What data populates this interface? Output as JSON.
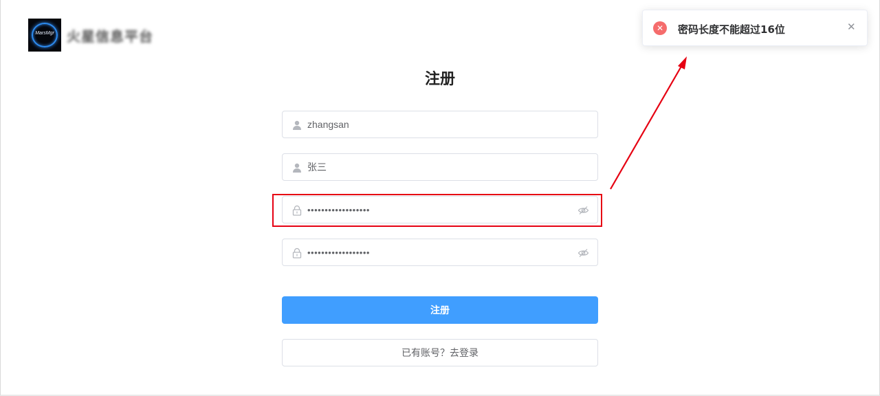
{
  "brand": {
    "logo_text": "MarsMgr",
    "name": "火星信息平台"
  },
  "toast": {
    "type": "error",
    "icon": "error-circle-icon",
    "message": "密码长度不能超过16位",
    "close_icon": "close-icon",
    "color": "#f56c6c"
  },
  "form": {
    "title": "注册",
    "username": {
      "value": "zhangsan",
      "icon": "user-icon"
    },
    "nickname": {
      "value": "张三",
      "icon": "user-icon"
    },
    "password": {
      "value": "••••••••••••••••••",
      "icon": "lock-icon",
      "toggle_icon": "eye-hidden-icon"
    },
    "confirm_password": {
      "value": "••••••••••••••••••",
      "icon": "lock-icon",
      "toggle_icon": "eye-hidden-icon"
    },
    "submit_label": "注册",
    "login_link_label": "已有账号？去登录"
  },
  "colors": {
    "primary": "#409eff",
    "error": "#f56c6c",
    "annotation": "#e60012"
  }
}
